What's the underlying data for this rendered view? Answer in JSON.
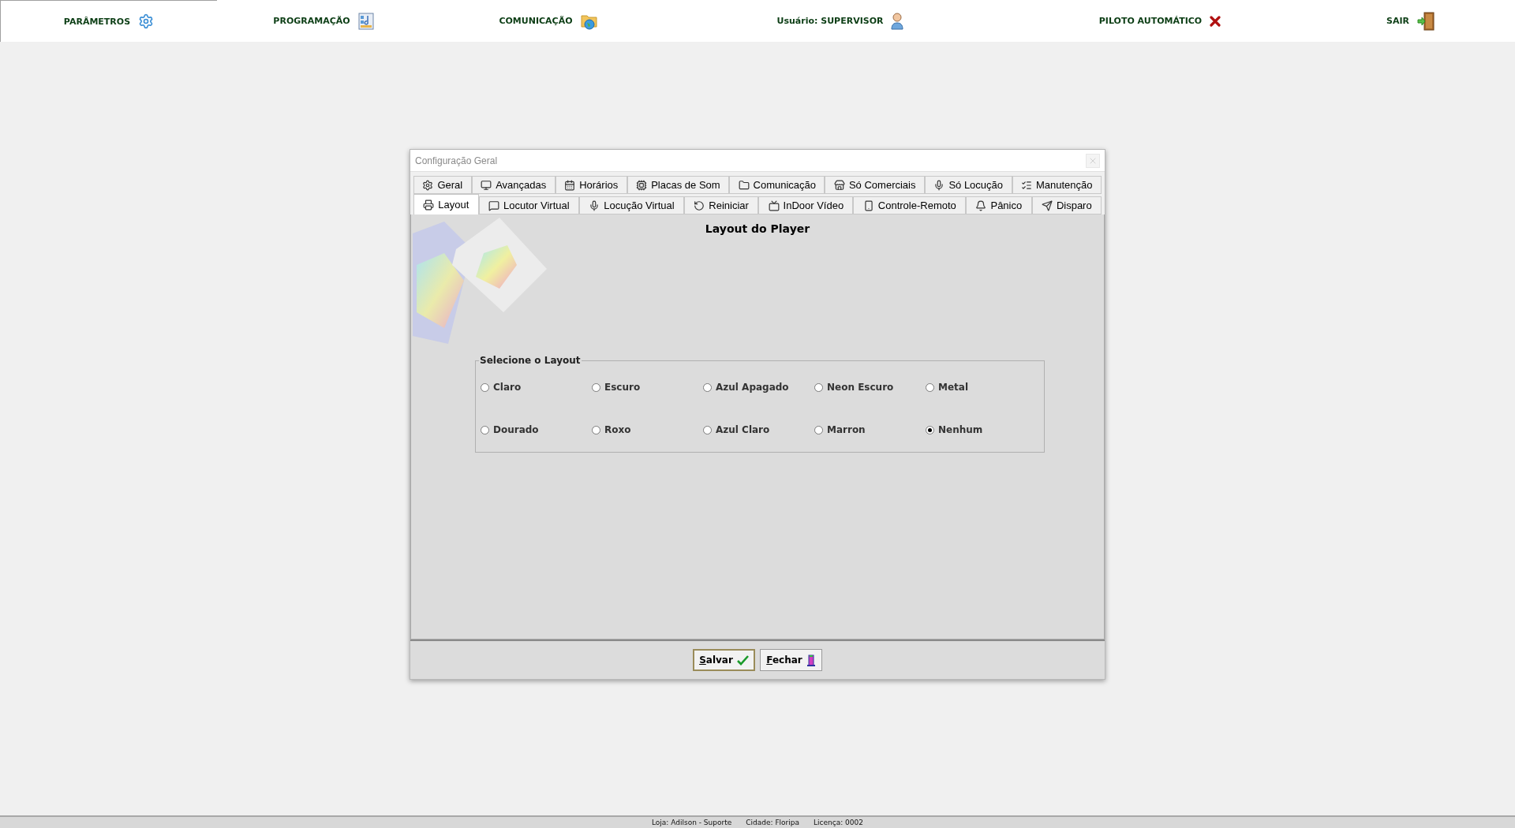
{
  "top_menu": [
    {
      "label": "PARÂMETROS"
    },
    {
      "label": "PROGRAMAÇÃO"
    },
    {
      "label": "COMUNICAÇÃO"
    },
    {
      "label": "Usuário: SUPERVISOR"
    },
    {
      "label": "PILOTO AUTOMÁTICO"
    },
    {
      "label": "SAIR"
    }
  ],
  "dialog": {
    "title": "Configuração Geral",
    "tab_rows": [
      [
        {
          "label": "Geral",
          "selected": false
        },
        {
          "label": "Avançadas",
          "selected": false
        },
        {
          "label": "Horários",
          "selected": false
        },
        {
          "label": "Placas de Som",
          "selected": false
        },
        {
          "label": "Comunicação",
          "selected": false
        },
        {
          "label": "Só Comerciais",
          "selected": false
        },
        {
          "label": "Só Locução",
          "selected": false
        },
        {
          "label": "Manutenção",
          "selected": false
        }
      ],
      [
        {
          "label": "Layout",
          "selected": true
        },
        {
          "label": "Locutor Virtual",
          "selected": false
        },
        {
          "label": "Locução Virtual",
          "selected": false
        },
        {
          "label": "Reiniciar",
          "selected": false
        },
        {
          "label": "InDoor Vídeo",
          "selected": false
        },
        {
          "label": "Controle-Remoto",
          "selected": false
        },
        {
          "label": "Pânico",
          "selected": false
        },
        {
          "label": "Disparo",
          "selected": false
        }
      ]
    ],
    "heading": "Layout do Player",
    "group": {
      "title": "Selecione o Layout",
      "options": [
        {
          "label": "Claro",
          "selected": false
        },
        {
          "label": "Escuro",
          "selected": false
        },
        {
          "label": "Azul Apagado",
          "selected": false
        },
        {
          "label": "Neon Escuro",
          "selected": false
        },
        {
          "label": "Metal",
          "selected": false
        },
        {
          "label": "Dourado",
          "selected": false
        },
        {
          "label": "Roxo",
          "selected": false
        },
        {
          "label": "Azul Claro",
          "selected": false
        },
        {
          "label": "Marron",
          "selected": false
        },
        {
          "label": "Nenhum",
          "selected": true
        }
      ]
    },
    "buttons": [
      {
        "label": "Salvar"
      },
      {
        "label": "Fechar"
      }
    ]
  },
  "status_bar": [
    "Loja: Adilson - Suporte",
    "Cidade: Floripa",
    "Licença: 0002"
  ]
}
